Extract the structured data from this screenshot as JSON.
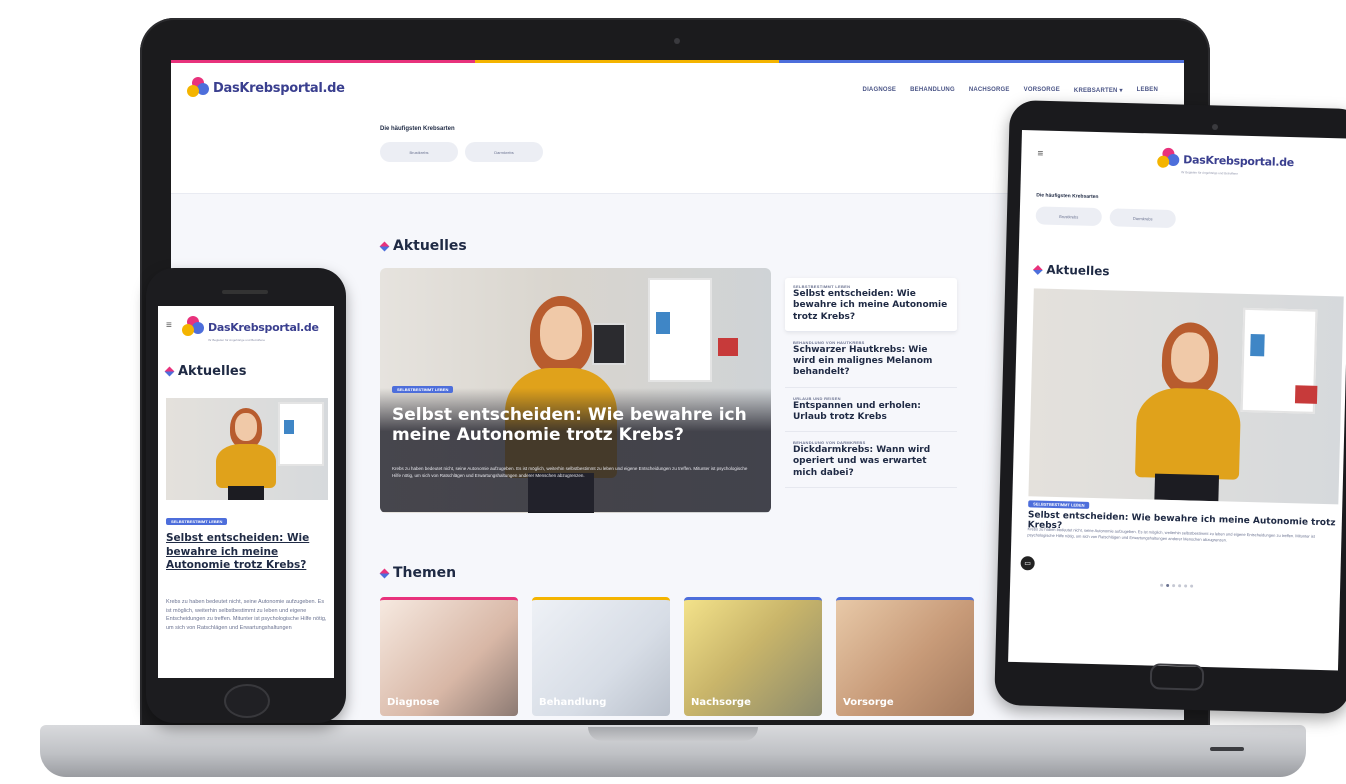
{
  "site": {
    "logo_text": "DasKrebsportal.de",
    "tagline": "Ihr Begleiter für Angehörige und Betroffene"
  },
  "nav": {
    "items": [
      "DIAGNOSE",
      "BEHANDLUNG",
      "NACHSORGE",
      "VORSORGE",
      "KREBSARTEN ▾",
      "LEBEN"
    ]
  },
  "search": {
    "label": "Die häufigsten Krebsarten",
    "pills": [
      "Brustkrebs",
      "Darmkrebs"
    ]
  },
  "aktuelles": {
    "title": "Aktuelles",
    "hero": {
      "badge": "SELBSTBESTIMMT LEBEN",
      "title": "Selbst entscheiden: Wie bewahre ich meine Autonomie trotz Krebs?",
      "text": "Krebs zu haben bedeutet nicht, seine Autonomie aufzugeben. Es ist möglich, weiterhin selbstbestimmt zu leben und eigene Entscheidungen zu treffen. Mitunter ist psychologische Hilfe nötig, um sich von Ratschlägen und Erwartungshaltungen anderer Menschen abzugrenzen."
    },
    "side": [
      {
        "category": "SELBSTBESTIMMT LEBEN",
        "title": "Selbst entscheiden: Wie bewahre ich meine Autonomie trotz Krebs?"
      },
      {
        "category": "BEHANDLUNG VON HAUTKREBS",
        "title": "Schwarzer Hautkrebs: Wie wird ein malignes Melanom behandelt?"
      },
      {
        "category": "URLAUB UND REISEN",
        "title": "Entspannen und erholen: Urlaub trotz Krebs"
      },
      {
        "category": "BEHANDLUNG VON DARMKREBS",
        "title": "Dickdarmkrebs: Wann wird operiert und was erwartet mich dabei?"
      }
    ]
  },
  "themen": {
    "title": "Themen",
    "cards": [
      {
        "label": "Diagnose",
        "bar": "#e8327c"
      },
      {
        "label": "Behandlung",
        "bar": "#f4b400"
      },
      {
        "label": "Nachsorge",
        "bar": "#4d6edb"
      },
      {
        "label": "Vorsorge",
        "bar": "#4d6edb"
      }
    ]
  },
  "phone": {
    "menu_icon": "menu-icon",
    "article_title": "Selbst entscheiden: Wie bewahre ich meine Autonomie trotz Krebs?",
    "article_text": "Krebs zu haben bedeutet nicht, seine Autonomie aufzugeben. Es ist möglich, weiterhin selbstbestimmt zu leben und eigene Entscheidungen zu treffen. Mitunter ist psychologische Hilfe nötig, um sich von Ratschlägen und Erwartungshaltungen"
  },
  "tablet": {
    "article_title": "Selbst entscheiden: Wie bewahre ich meine Autonomie trotz Krebs?",
    "article_text": "Krebs zu haben bedeutet nicht, seine Autonomie aufzugeben. Es ist möglich, weiterhin selbstbestimmt zu leben und eigene Entscheidungen zu treffen. Mitunter ist psychologische Hilfe nötig, um sich von Ratschlägen und Erwartungshaltungen anderer Menschen abzugrenzen."
  },
  "colors": {
    "brand_pink": "#e8327c",
    "brand_yellow": "#f4b400",
    "brand_blue": "#4d6edb",
    "brand_navy": "#3a3f8f"
  }
}
